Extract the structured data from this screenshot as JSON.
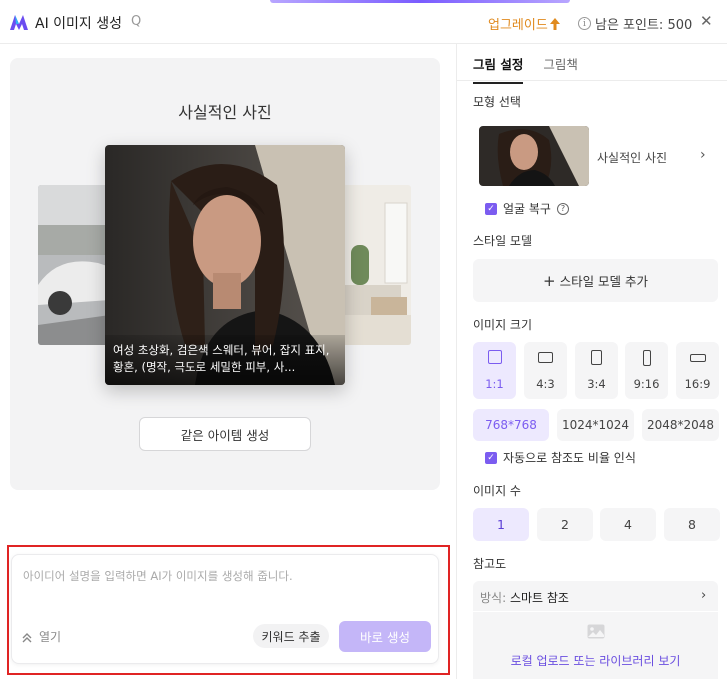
{
  "app": {
    "title": "AI 이미지 생성",
    "title_search_glyph": "Q",
    "upgrade_label": "업그레이드",
    "points_label": "남은 포인트: 500",
    "close_glyph": "✕"
  },
  "preview": {
    "title": "사실적인 사진",
    "caption": "여성 초상화, 검은색 스웨터, 뷰어, 잡지 표지, 황혼, (명작, 극도로 세밀한 피부, 사...",
    "same_item_button": "같은 아이템 생성"
  },
  "prompt": {
    "placeholder": "아이디어 설명을 입력하면 AI가 이미지를 생성해 줍니다.",
    "expand_label": "열기",
    "keyword_button": "키워드 추출",
    "generate_button": "바로 생성"
  },
  "panel": {
    "tabs": [
      {
        "label": "그림 설정",
        "active": true
      },
      {
        "label": "그림책",
        "active": false
      }
    ],
    "model_section": "모형 선택",
    "model_name": "사실적인 사진",
    "face_restore": "얼굴 복구",
    "style_model_section": "스타일 모델",
    "add_style_model": "스타일 모델 추가",
    "size_section": "이미지 크기",
    "ratios": [
      {
        "label": "1:1",
        "active": true
      },
      {
        "label": "4:3",
        "active": false
      },
      {
        "label": "3:4",
        "active": false
      },
      {
        "label": "9:16",
        "active": false
      },
      {
        "label": "16:9",
        "active": false
      }
    ],
    "resolutions": [
      {
        "label": "768*768",
        "active": true
      },
      {
        "label": "1024*1024",
        "active": false
      },
      {
        "label": "2048*2048",
        "active": false
      }
    ],
    "auto_ratio": "자동으로 참조도 비율 인식",
    "count_section": "이미지 수",
    "counts": [
      {
        "label": "1",
        "active": true
      },
      {
        "label": "2",
        "active": false
      },
      {
        "label": "4",
        "active": false
      },
      {
        "label": "8",
        "active": false
      }
    ],
    "reference_section": "참고도",
    "reference_mode_prefix": "방식:",
    "reference_mode": "스마트 참조",
    "upload_text": "로컬 업로드 또는 라이브러리 보기"
  },
  "colors": {
    "accent": "#7b5cf0",
    "upgrade": "#e08a1e",
    "highlight_border": "#e02424"
  }
}
